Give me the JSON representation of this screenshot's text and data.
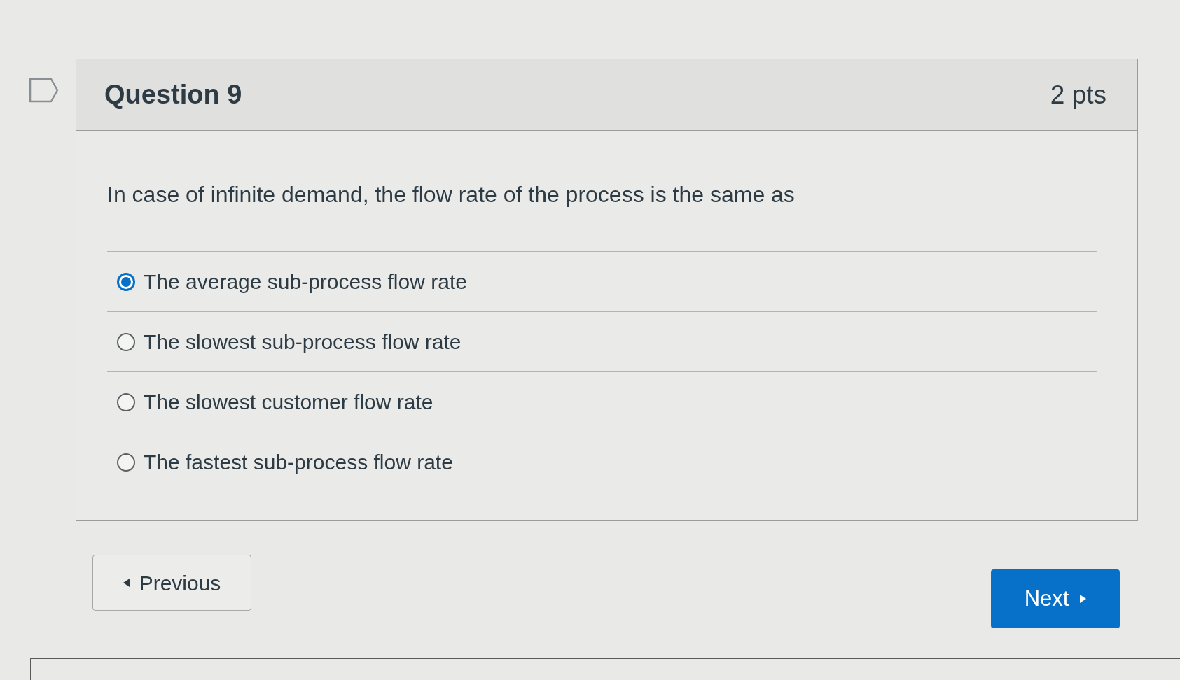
{
  "question": {
    "title": "Question 9",
    "points": "2 pts",
    "flagged": false,
    "text": "In case of infinite demand, the flow rate of the process is the same as",
    "answers": [
      {
        "label": "The average sub-process flow rate",
        "selected": true
      },
      {
        "label": "The slowest sub-process flow rate",
        "selected": false
      },
      {
        "label": "The slowest customer flow rate",
        "selected": false
      },
      {
        "label": "The fastest sub-process flow rate",
        "selected": false
      }
    ]
  },
  "navigation": {
    "previous": "Previous",
    "next": "Next"
  }
}
